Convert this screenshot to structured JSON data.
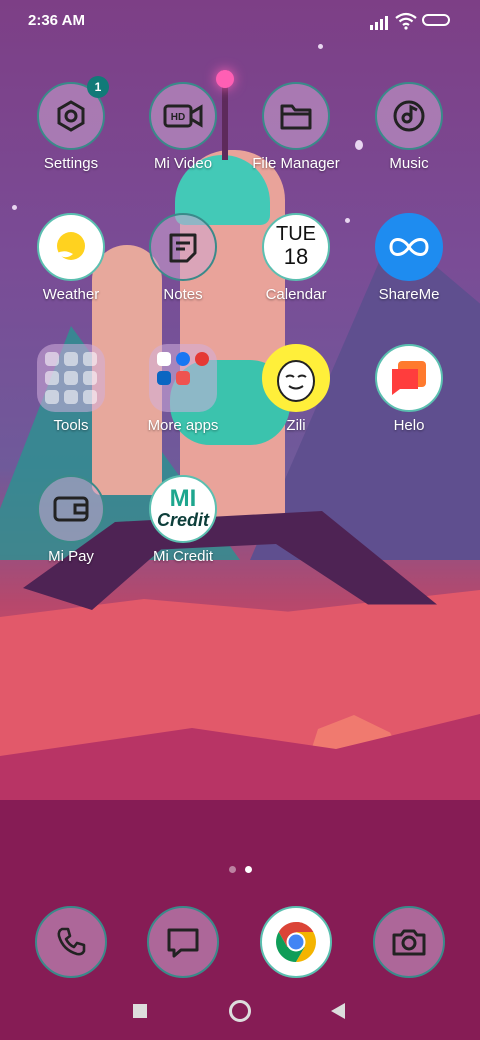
{
  "status_bar": {
    "time": "2:36 AM"
  },
  "apps": {
    "settings": {
      "label": "Settings",
      "badge": "1"
    },
    "mi_video": {
      "label": "Mi Video",
      "icon_text": "HD"
    },
    "file_manager": {
      "label": "File Manager"
    },
    "music": {
      "label": "Music"
    },
    "weather": {
      "label": "Weather"
    },
    "notes": {
      "label": "Notes"
    },
    "calendar": {
      "label": "Calendar",
      "day": "TUE",
      "date": "18"
    },
    "shareme": {
      "label": "ShareMe"
    },
    "tools": {
      "label": "Tools"
    },
    "more_apps": {
      "label": "More apps"
    },
    "zili": {
      "label": "Zili"
    },
    "helo": {
      "label": "Helo"
    },
    "mi_pay": {
      "label": "Mi Pay"
    },
    "mi_credit": {
      "label": "Mi Credit",
      "logo_mi": "MI",
      "logo_text": "Credit"
    }
  },
  "page_indicator": {
    "pages": 2,
    "current": 2
  },
  "dock": [
    "phone-icon",
    "messaging-icon",
    "chrome-icon",
    "camera-icon"
  ],
  "colors": {
    "accent": "#117a78",
    "icon_border": "#3a8a8a"
  }
}
